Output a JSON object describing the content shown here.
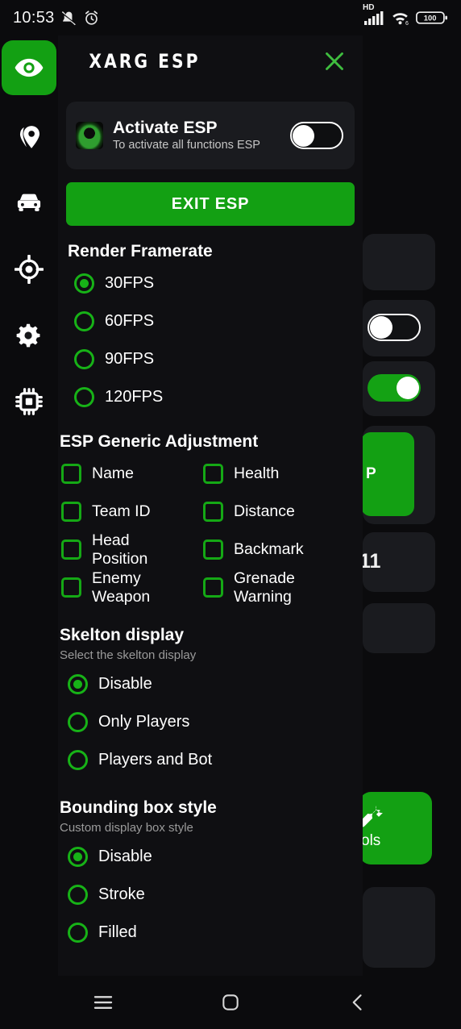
{
  "status_bar": {
    "time": "10:53",
    "left_icons": [
      "mute-icon",
      "alarm-icon"
    ],
    "network_label": "HD",
    "signal_icon": "signal-bars-icon",
    "wifi_icon": "wifi-6-icon",
    "battery_level": "100"
  },
  "colors": {
    "accent_green": "#13a013",
    "bright_green": "#17b217",
    "panel_bg": "#0f0f12",
    "card_bg": "#1a1b1f",
    "screen_bg": "#0b0b0d",
    "text_primary": "#ffffff",
    "text_secondary": "#9a9a9a"
  },
  "rail": {
    "items": [
      {
        "icon": "eye-icon",
        "active": true
      },
      {
        "icon": "location-pin-icon",
        "active": false
      },
      {
        "icon": "car-icon",
        "active": false
      },
      {
        "icon": "crosshair-target-icon",
        "active": false
      },
      {
        "icon": "gear-icon",
        "active": false
      },
      {
        "icon": "chip-cpu-icon",
        "active": false
      }
    ]
  },
  "panel": {
    "title": "XARG ESP",
    "close_icon": "close-x-icon",
    "activate_card": {
      "logo_icon": "xarg-logo-icon",
      "title": "Activate ESP",
      "subtitle": "To activate all functions ESP",
      "toggle_state": "off"
    },
    "exit_button": "EXIT ESP",
    "render_framerate": {
      "title": "Render Framerate",
      "options": [
        {
          "label": "30FPS",
          "selected": true
        },
        {
          "label": "60FPS",
          "selected": false
        },
        {
          "label": "90FPS",
          "selected": false
        },
        {
          "label": "120FPS",
          "selected": false
        }
      ]
    },
    "esp_generic_adjustment": {
      "title": "ESP Generic Adjustment",
      "items": [
        {
          "label": "Name",
          "checked": false
        },
        {
          "label": "Health",
          "checked": false
        },
        {
          "label": "Team ID",
          "checked": false
        },
        {
          "label": "Distance",
          "checked": false
        },
        {
          "label": "Head Position",
          "checked": false
        },
        {
          "label": "Backmark",
          "checked": false
        },
        {
          "label": "Enemy Weapon",
          "checked": false
        },
        {
          "label": "Grenade Warning",
          "checked": false
        }
      ]
    },
    "skelton_display": {
      "title": "Skelton display",
      "subtitle": "Select the skelton display",
      "options": [
        {
          "label": "Disable",
          "selected": true
        },
        {
          "label": "Only Players",
          "selected": false
        },
        {
          "label": "Players and Bot",
          "selected": false
        }
      ]
    },
    "bounding_box_style": {
      "title": "Bounding box style",
      "subtitle": "Custom display box style",
      "options": [
        {
          "label": "Disable",
          "selected": true
        },
        {
          "label": "Stroke",
          "selected": false
        },
        {
          "label": "Filled",
          "selected": false
        }
      ]
    }
  },
  "background_app": {
    "toggle_off_state": "off",
    "toggle_on_state": "on",
    "green_button_text": "P",
    "partial_text": "11",
    "tile_label": "ols",
    "tile_icon": "wrench-tools-icon"
  },
  "nav_bar": {
    "recents_icon": "recents-menu-icon",
    "home_icon": "home-square-icon",
    "back_icon": "back-chevron-icon"
  }
}
